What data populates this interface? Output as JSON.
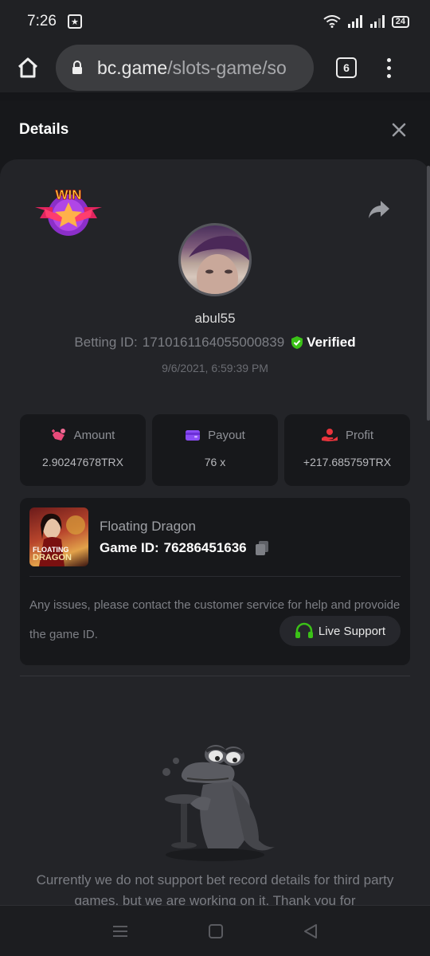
{
  "status_bar": {
    "time": "7:26",
    "app_icon": "photo-icon",
    "battery": "24"
  },
  "browser": {
    "url_host": "bc.game",
    "url_path": "/slots-game/so",
    "tab_count": "6"
  },
  "modal": {
    "title": "Details"
  },
  "bet": {
    "badge": "WIN",
    "username": "abul55",
    "betting_id_label": "Betting ID:",
    "betting_id": "1710161164055000839",
    "verified_label": "Verified",
    "datetime": "9/6/2021, 6:59:39 PM"
  },
  "stats": [
    {
      "label": "Amount",
      "value": "2.90247678TRX",
      "icon": "amount-icon",
      "color": "#e94a7a"
    },
    {
      "label": "Payout",
      "value": "76 x",
      "icon": "wallet-icon",
      "color": "#8a4cf5"
    },
    {
      "label": "Profit",
      "value": "+217.685759TRX",
      "icon": "profit-icon",
      "color": "#e8343c"
    }
  ],
  "game": {
    "thumb_title_line1": "Floating",
    "thumb_title_line2": "Dragon",
    "name": "Floating Dragon",
    "id_label": "Game ID:",
    "id": "76286451636",
    "issue_text": "Any issues, please contact the customer service for help and provoide the game ID.",
    "support_label": "Live Support"
  },
  "notice": "Currently we do not support bet record details for third party games, but we are working on it. Thank you for",
  "colors": {
    "accent_green": "#3bc117",
    "panel_bg": "#232428",
    "card_bg": "#17181b"
  }
}
